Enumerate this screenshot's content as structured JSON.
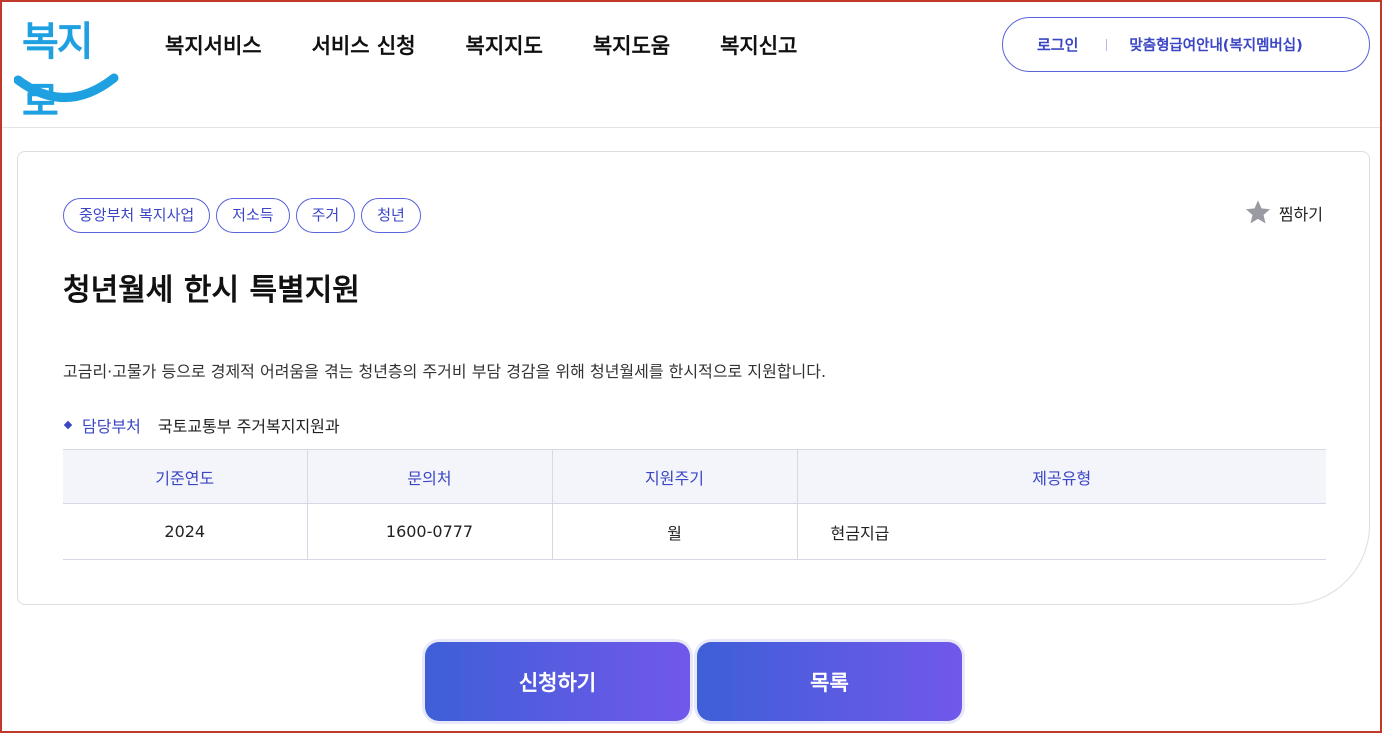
{
  "brand": {
    "logo_text": "복지로"
  },
  "nav": {
    "items": [
      {
        "label": "복지서비스"
      },
      {
        "label": "서비스 신청"
      },
      {
        "label": "복지지도"
      },
      {
        "label": "복지도움"
      },
      {
        "label": "복지신고"
      }
    ]
  },
  "util": {
    "login": "로그인",
    "membership": "맞춤형급여안내(복지멤버십)"
  },
  "detail": {
    "tags": [
      "중앙부처 복지사업",
      "저소득",
      "주거",
      "청년"
    ],
    "favorite_label": "찜하기",
    "title": "청년월세 한시 특별지원",
    "description": "고금리·고물가 등으로 경제적 어려움을 겪는 청년층의 주거비 부담 경감을 위해 청년월세를 한시적으로 지원합니다.",
    "dept_label": "담당부처",
    "dept_value": "국토교통부 주거복지지원과",
    "table": {
      "headers": [
        "기준연도",
        "문의처",
        "지원주기",
        "제공유형"
      ],
      "row": [
        "2024",
        "1600-0777",
        "월",
        "현금지급"
      ]
    }
  },
  "actions": {
    "apply": "신청하기",
    "list": "목록"
  },
  "colors": {
    "accent": "#3b46c4",
    "logo_blue": "#1fa0e0",
    "button_start": "#3e5fd8",
    "button_end": "#7158ea"
  }
}
